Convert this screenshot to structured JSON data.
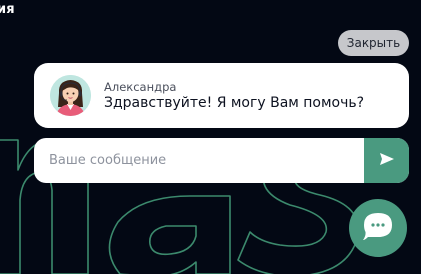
{
  "page": {
    "heading_fragment": "ия",
    "background_text": "nas"
  },
  "chat": {
    "close_label": "Закрыть",
    "agent": {
      "name": "Александра",
      "message": "Здравствуйте! Я могу Вам помочь?"
    },
    "input": {
      "value": "",
      "placeholder": "Ваше сообщение"
    }
  },
  "colors": {
    "background": "#030814",
    "accent": "#4a9a80",
    "close_button": "#c6c7cb",
    "bubble": "#ffffff"
  },
  "icons": {
    "send": "send-icon",
    "launcher": "chat-bubble-icon"
  }
}
